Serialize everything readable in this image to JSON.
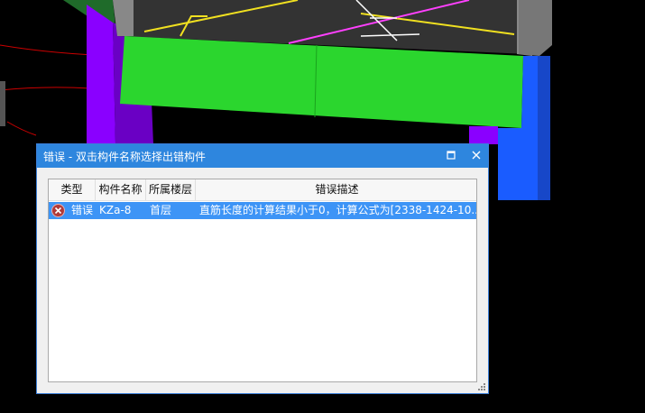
{
  "dialog": {
    "title": "错误 - 双击构件名称选择出错构件",
    "maximize_icon": "maximize-icon",
    "close_icon": "close-icon"
  },
  "table": {
    "columns": [
      "类型",
      "构件名称",
      "所属楼层",
      "错误描述"
    ],
    "rows": [
      {
        "icon": "error-icon",
        "type": "错误",
        "name": "KZa-8",
        "floor": "首层",
        "description": "直筋长度的计算结果小于0，计算公式为[2338-1424-10..."
      }
    ]
  },
  "colors": {
    "title_bar": "#2e86de",
    "selection": "#3d94f6",
    "green_slab": "#2bd62e",
    "purple_column": "#8a00ff",
    "blue_column": "#1a5cff"
  }
}
